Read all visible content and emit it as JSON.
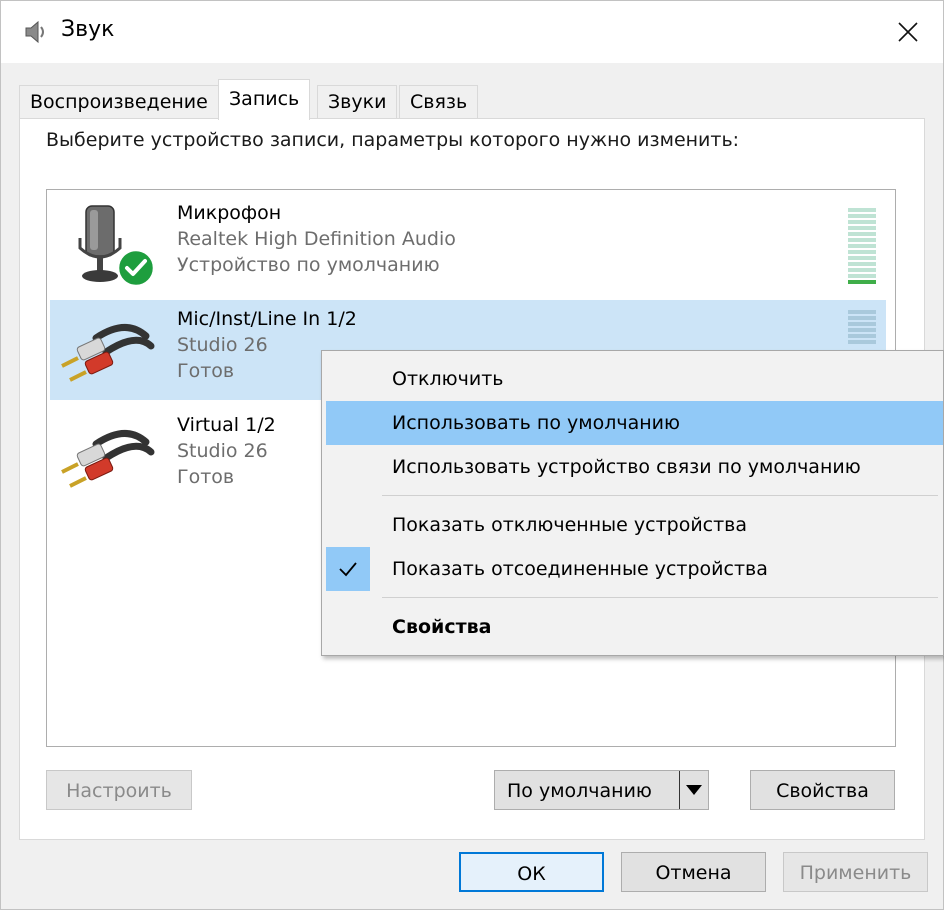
{
  "window": {
    "title": "Звук",
    "close_label": "✕"
  },
  "tabs": [
    {
      "label": "Воспроизведение",
      "active": false
    },
    {
      "label": "Запись",
      "active": true
    },
    {
      "label": "Звуки",
      "active": false
    },
    {
      "label": "Связь",
      "active": false
    }
  ],
  "instruction": "Выберите устройство записи, параметры которого нужно изменить:",
  "devices": [
    {
      "name": "Микрофон",
      "driver": "Realtek High Definition Audio",
      "status": "Устройство по умолчанию",
      "icon": "microphone-icon",
      "default_badge": true
    },
    {
      "name": "Mic/Inst/Line In 1/2",
      "driver": "Studio 26",
      "status": "Готов",
      "icon": "rca-cable-icon",
      "selected": true
    },
    {
      "name": "Virtual 1/2",
      "driver": "Studio 26",
      "status": "Готов",
      "icon": "rca-cable-icon"
    }
  ],
  "context_menu": {
    "items": [
      {
        "label": "Отключить"
      },
      {
        "label": "Использовать по умолчанию",
        "hover": true
      },
      {
        "label": "Использовать устройство связи по умолчанию"
      },
      {
        "label": "Показать отключенные устройства"
      },
      {
        "label": "Показать отсоединенные устройства",
        "checked": true
      },
      {
        "label": "Свойства",
        "bold": true
      }
    ]
  },
  "buttons": {
    "configure": "Настроить",
    "set_default": "По умолчанию",
    "properties": "Свойства",
    "ok": "ОК",
    "cancel": "Отмена",
    "apply": "Применить"
  },
  "colors": {
    "selection": "#cce4f7",
    "menu_hover": "#91c9f7",
    "accent": "#0078d7",
    "level_on": "#3fae49"
  }
}
